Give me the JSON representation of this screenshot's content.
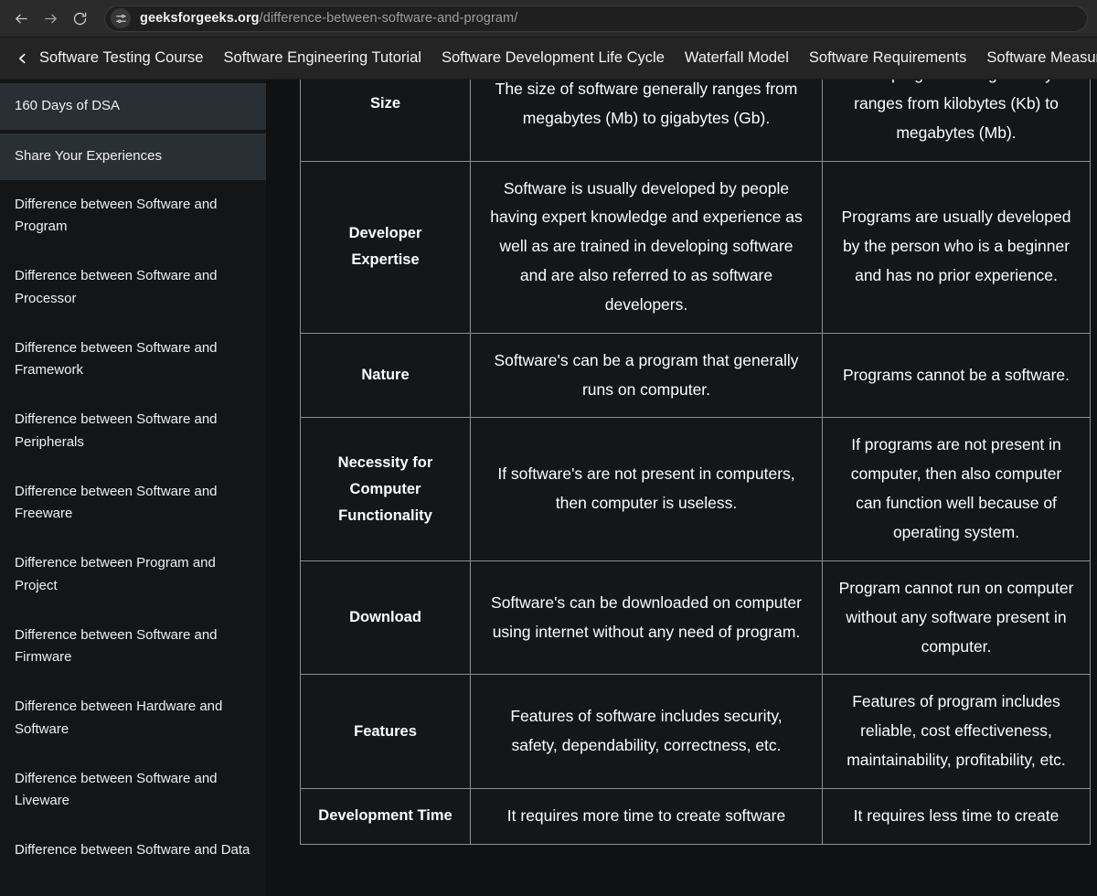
{
  "browser": {
    "back_icon": "arrow-left-icon",
    "forward_icon": "arrow-right-icon",
    "reload_icon": "reload-icon",
    "site_settings_icon": "tune-sliders-icon",
    "url_domain": "geeksforgeeks.org",
    "url_path": "/difference-between-software-and-program/"
  },
  "site_nav": {
    "back_chevron_icon": "chevron-left-icon",
    "items": [
      {
        "label": "Software Testing Course"
      },
      {
        "label": "Software Engineering Tutorial"
      },
      {
        "label": "Software Development Life Cycle"
      },
      {
        "label": "Waterfall Model"
      },
      {
        "label": "Software Requirements"
      },
      {
        "label": "Software Measurement"
      }
    ]
  },
  "sidebar": {
    "items": [
      {
        "label": "160 Days of DSA",
        "style": "boxed"
      },
      {
        "label": "Share Your Experiences",
        "style": "boxed"
      },
      {
        "label": "Difference between Software and Program",
        "style": "plain"
      },
      {
        "label": "Difference between Software and Processor",
        "style": "plain"
      },
      {
        "label": "Difference between Software and Framework",
        "style": "plain"
      },
      {
        "label": "Difference between Software and Peripherals",
        "style": "plain"
      },
      {
        "label": "Difference between Software and Freeware",
        "style": "plain"
      },
      {
        "label": "Difference between Program and Project",
        "style": "plain"
      },
      {
        "label": "Difference between Software and Firmware",
        "style": "plain"
      },
      {
        "label": "Difference between Hardware and Software",
        "style": "plain"
      },
      {
        "label": "Difference between Software and Liveware",
        "style": "plain"
      },
      {
        "label": "Difference between Software and Data",
        "style": "plain"
      }
    ]
  },
  "table": {
    "rows": [
      {
        "feature": "Size",
        "software": "The size of software generally ranges from megabytes (Mb) to gigabytes (Gb).",
        "program": "The program size generally ranges from kilobytes (Kb) to megabytes (Mb)."
      },
      {
        "feature": "Developer Expertise",
        "software": "Software is usually developed by people having expert knowledge and experience as well as are trained in developing software and are also referred to as software developers.",
        "program": "Programs are usually developed by the person who is a beginner and has no prior experience."
      },
      {
        "feature": "Nature",
        "software": "Software's can be a program that generally runs on computer.",
        "program": "Programs cannot be a software."
      },
      {
        "feature": "Necessity for Computer Functionality",
        "software": "If software's are not present in computers, then computer is useless.",
        "program": "If programs are not present in computer, then also computer can function well because of operating system."
      },
      {
        "feature": "Download",
        "software": "Software's can be downloaded on computer using internet without any need of program.",
        "program": "Program cannot run on computer without any software present in computer."
      },
      {
        "feature": "Features",
        "software": "Features of software includes security, safety, dependability, correctness, etc.",
        "program": "Features of program includes reliable, cost effectiveness, maintainability, profitability, etc."
      },
      {
        "feature": "Development Time",
        "software": "It requires more time to create software",
        "program": "It requires less time to create"
      }
    ]
  }
}
